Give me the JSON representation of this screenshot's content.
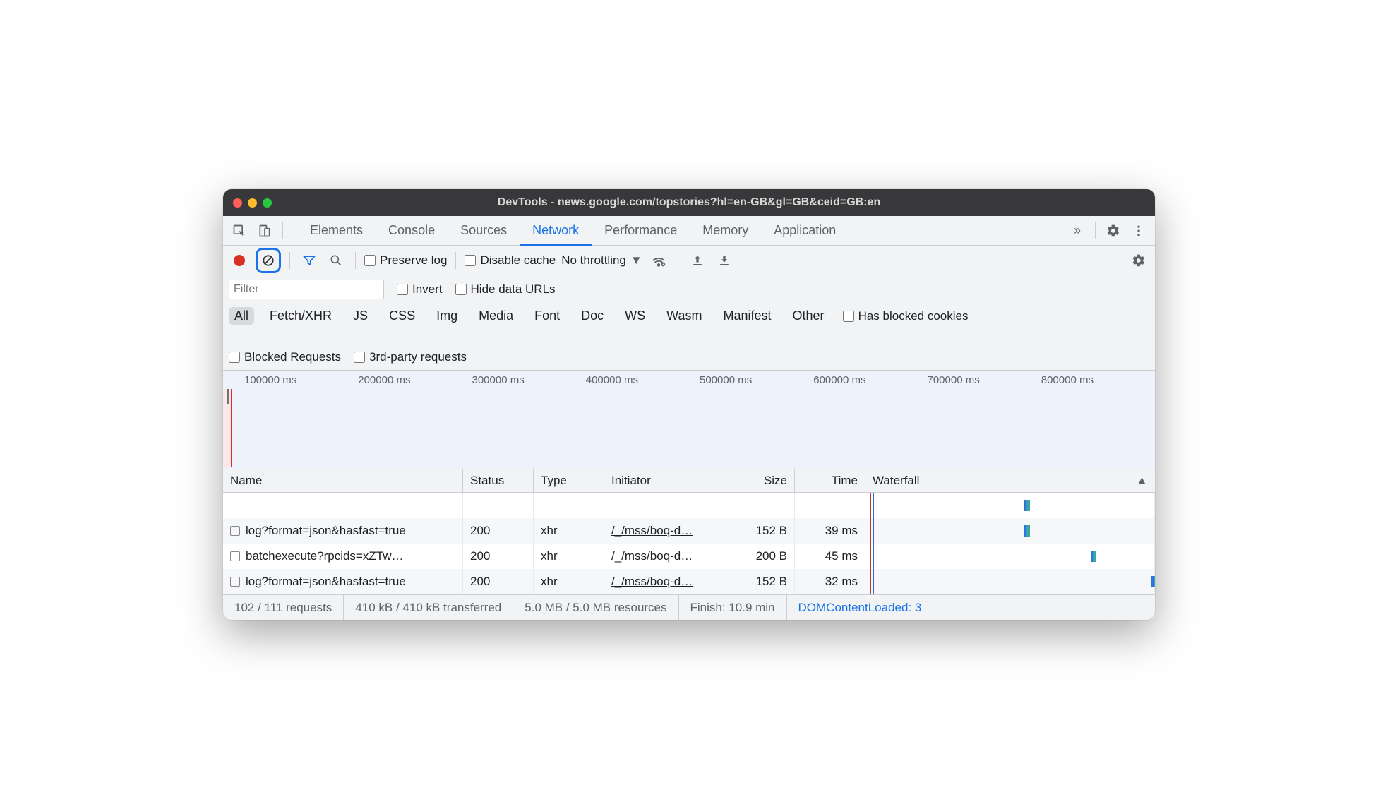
{
  "window": {
    "title": "DevTools - news.google.com/topstories?hl=en-GB&gl=GB&ceid=GB:en"
  },
  "tabs": {
    "items": [
      "Elements",
      "Console",
      "Sources",
      "Network",
      "Performance",
      "Memory",
      "Application"
    ],
    "active": "Network",
    "overflow": "»"
  },
  "toolbar": {
    "preserve_log": "Preserve log",
    "disable_cache": "Disable cache",
    "throttling": "No throttling"
  },
  "filter": {
    "placeholder": "Filter",
    "invert": "Invert",
    "hide_data_urls": "Hide data URLs",
    "types": [
      "All",
      "Fetch/XHR",
      "JS",
      "CSS",
      "Img",
      "Media",
      "Font",
      "Doc",
      "WS",
      "Wasm",
      "Manifest",
      "Other"
    ],
    "active_type": "All",
    "has_blocked_cookies": "Has blocked cookies",
    "blocked_requests": "Blocked Requests",
    "third_party": "3rd-party requests"
  },
  "timeline": {
    "ticks": [
      "100000 ms",
      "200000 ms",
      "300000 ms",
      "400000 ms",
      "500000 ms",
      "600000 ms",
      "700000 ms",
      "800000 ms"
    ]
  },
  "columns": {
    "name": "Name",
    "status": "Status",
    "type": "Type",
    "initiator": "Initiator",
    "size": "Size",
    "time": "Time",
    "waterfall": "Waterfall"
  },
  "rows": [
    {
      "name": "log?format=json&hasfast=true",
      "status": "200",
      "type": "xhr",
      "initiator": "/_/mss/boq-d…",
      "size": "152 B",
      "time": "39 ms",
      "wf_left": "55%"
    },
    {
      "name": "batchexecute?rpcids=xZTw…",
      "status": "200",
      "type": "xhr",
      "initiator": "/_/mss/boq-d…",
      "size": "200 B",
      "time": "45 ms",
      "wf_left": "78%"
    },
    {
      "name": "log?format=json&hasfast=true",
      "status": "200",
      "type": "xhr",
      "initiator": "/_/mss/boq-d…",
      "size": "152 B",
      "time": "32 ms",
      "wf_left": "99%"
    }
  ],
  "status": {
    "requests": "102 / 111 requests",
    "transferred": "410 kB / 410 kB transferred",
    "resources": "5.0 MB / 5.0 MB resources",
    "finish": "Finish: 10.9 min",
    "dcl": "DOMContentLoaded: 3"
  }
}
